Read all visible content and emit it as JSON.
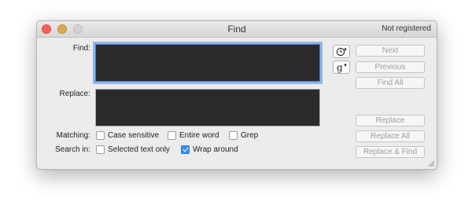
{
  "window": {
    "title": "Find",
    "registration": "Not registered"
  },
  "find": {
    "label": "Find:",
    "value": "",
    "history_icon": "clock-icon",
    "grep_icon": "g"
  },
  "replace": {
    "label": "Replace:",
    "value": ""
  },
  "buttons": {
    "next": "Next",
    "previous": "Previous",
    "find_all": "Find All",
    "replace": "Replace",
    "replace_all": "Replace All",
    "replace_find": "Replace & Find"
  },
  "matching": {
    "label": "Matching:",
    "options": [
      {
        "label": "Case sensitive",
        "checked": false
      },
      {
        "label": "Entire word",
        "checked": false
      },
      {
        "label": "Grep",
        "checked": false
      }
    ]
  },
  "search_in": {
    "label": "Search in:",
    "options": [
      {
        "label": "Selected text only",
        "checked": false
      },
      {
        "label": "Wrap around",
        "checked": true
      }
    ]
  },
  "colors": {
    "field_bg": "#2b2a2d",
    "focus_ring": "#8fb6ea",
    "checkbox_on": "#3c8ef5"
  }
}
